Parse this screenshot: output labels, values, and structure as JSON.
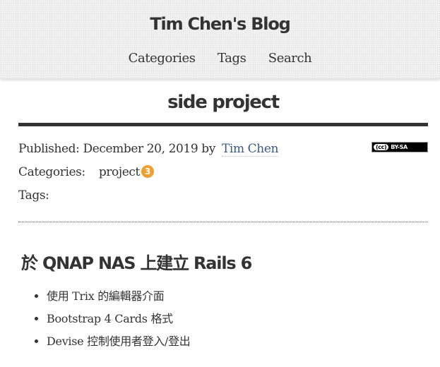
{
  "site": {
    "title": "Tim Chen's Blog"
  },
  "nav": {
    "items": [
      "Categories",
      "Tags",
      "Search"
    ]
  },
  "post": {
    "title": "side project",
    "published_label": "Published: December 20, 2019 by",
    "author": "Tim Chen",
    "license_badge": {
      "left": "(cc)",
      "right": "BY-SA"
    },
    "categories_label": "Categories:",
    "category": "project",
    "category_count": "3",
    "tags_label": "Tags:",
    "section_heading": "於 QNAP NAS 上建立 Rails 6",
    "features": [
      "使用 Trix 的編輯器介面",
      "Bootstrap 4 Cards 格式",
      "Devise 控制使用者登入/登出"
    ]
  },
  "colors": {
    "accent_badge": "#f0a030",
    "link": "#3d5a80",
    "text": "#333333"
  }
}
